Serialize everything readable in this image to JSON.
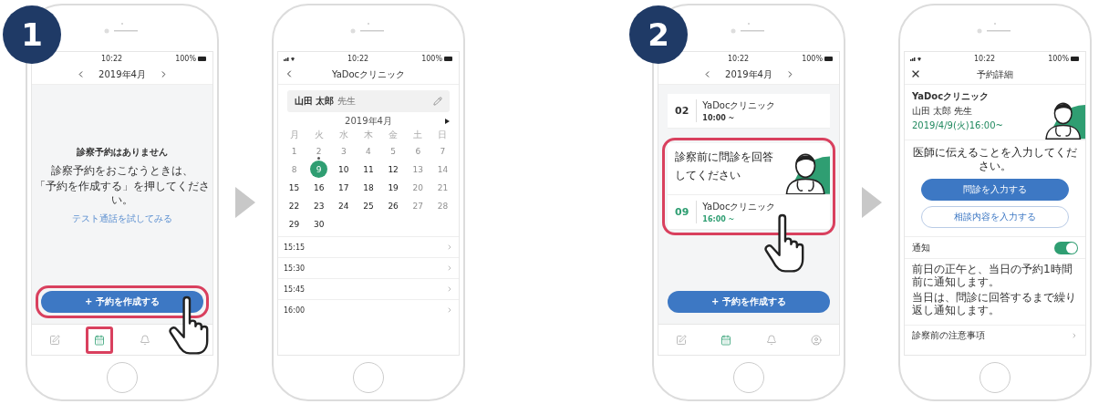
{
  "steps": [
    {
      "number": "1",
      "screens": [
        {
          "kind": "no_appointments",
          "status": {
            "time": "10:22",
            "battery": "100%"
          },
          "month": "2019年4月",
          "empty_title": "診察予約はありません",
          "empty_text": [
            "診察予約をおこなうときは、",
            "「予約を作成する」を押してください。"
          ],
          "test_link": "テスト通話を試してみる",
          "create_button": {
            "label": "+ 予約を作成する",
            "highlighted": true,
            "tapped": true
          },
          "tabs": [
            {
              "selected": false,
              "highlighted": false
            },
            {
              "selected": true,
              "highlighted": true
            },
            {
              "selected": false,
              "highlighted": false
            }
          ]
        },
        {
          "kind": "calendar",
          "status": {
            "time": "10:22",
            "battery": "100%"
          },
          "title": "YaDocクリニック",
          "doctor": {
            "name": "山田 太郎",
            "honorific": "先生"
          },
          "month": "2019年4月",
          "weekdays": [
            "月",
            "火",
            "水",
            "木",
            "金",
            "土",
            "日"
          ],
          "days": [
            {
              "label": "1",
              "disabled": true,
              "selected": false,
              "dot": false
            },
            {
              "label": "2",
              "disabled": true,
              "selected": false,
              "dot": true
            },
            {
              "label": "3",
              "disabled": true,
              "selected": false,
              "dot": false
            },
            {
              "label": "4",
              "disabled": true,
              "selected": false,
              "dot": false
            },
            {
              "label": "5",
              "disabled": true,
              "selected": false,
              "dot": false
            },
            {
              "label": "6",
              "disabled": true,
              "selected": false,
              "dot": false
            },
            {
              "label": "7",
              "disabled": true,
              "selected": false,
              "dot": false
            },
            {
              "label": "8",
              "disabled": true,
              "selected": false,
              "dot": false
            },
            {
              "label": "9",
              "disabled": false,
              "selected": true,
              "dot": false
            },
            {
              "label": "10",
              "disabled": false,
              "selected": false,
              "dot": false
            },
            {
              "label": "11",
              "disabled": false,
              "selected": false,
              "dot": false
            },
            {
              "label": "12",
              "disabled": false,
              "selected": false,
              "dot": false
            },
            {
              "label": "13",
              "disabled": true,
              "selected": false,
              "dot": false
            },
            {
              "label": "14",
              "disabled": true,
              "selected": false,
              "dot": false
            },
            {
              "label": "15",
              "disabled": false,
              "selected": false,
              "dot": false
            },
            {
              "label": "16",
              "disabled": false,
              "selected": false,
              "dot": false
            },
            {
              "label": "17",
              "disabled": false,
              "selected": false,
              "dot": false
            },
            {
              "label": "18",
              "disabled": false,
              "selected": false,
              "dot": false
            },
            {
              "label": "19",
              "disabled": false,
              "selected": false,
              "dot": false
            },
            {
              "label": "20",
              "disabled": true,
              "selected": false,
              "dot": false
            },
            {
              "label": "21",
              "disabled": true,
              "selected": false,
              "dot": false
            },
            {
              "label": "22",
              "disabled": false,
              "selected": false,
              "dot": false
            },
            {
              "label": "23",
              "disabled": false,
              "selected": false,
              "dot": false
            },
            {
              "label": "24",
              "disabled": false,
              "selected": false,
              "dot": false
            },
            {
              "label": "25",
              "disabled": false,
              "selected": false,
              "dot": false
            },
            {
              "label": "26",
              "disabled": false,
              "selected": false,
              "dot": false
            },
            {
              "label": "27",
              "disabled": true,
              "selected": false,
              "dot": false
            },
            {
              "label": "28",
              "disabled": true,
              "selected": false,
              "dot": false
            },
            {
              "label": "29",
              "disabled": false,
              "selected": false,
              "dot": false
            },
            {
              "label": "30",
              "disabled": false,
              "selected": false,
              "dot": false
            }
          ],
          "times": [
            "15:15",
            "15:30",
            "15:45",
            "16:00"
          ]
        }
      ]
    },
    {
      "number": "2",
      "screens": [
        {
          "kind": "appointments",
          "status": {
            "time": "10:22",
            "battery": "100%"
          },
          "month": "2019年4月",
          "appointments": [
            {
              "day": "02",
              "clinic": "YaDocクリニック",
              "time": "10:00 ~",
              "upcoming": false,
              "highlighted": false
            },
            {
              "day": "09",
              "clinic": "YaDocクリニック",
              "time": "16:00 ~",
              "upcoming": true,
              "highlighted": true,
              "tapped": true,
              "prompt": [
                "診察前に問診を回答",
                "してください"
              ]
            }
          ],
          "create_button": {
            "label": "+ 予約を作成する",
            "highlighted": false,
            "tapped": false
          },
          "tabs": [
            {
              "selected": false,
              "highlighted": false
            },
            {
              "selected": true,
              "highlighted": false
            },
            {
              "selected": false,
              "highlighted": false
            },
            {
              "selected": false,
              "highlighted": false
            }
          ]
        },
        {
          "kind": "detail",
          "status": {
            "time": "10:22",
            "battery": "100%"
          },
          "title": "予約詳細",
          "clinic": "YaDocクリニック",
          "doctor": "山田 太郎 先生",
          "datetime": "2019/4/9(火)16:00~",
          "instruction": "医師に伝えることを入力してください。",
          "buttons": [
            {
              "label": "問診を入力する",
              "primary": true
            },
            {
              "label": "相談内容を入力する",
              "primary": false
            }
          ],
          "notification": {
            "label": "通知",
            "on": true
          },
          "note_lines": [
            "前日の正午と、当日の予約1時間前に通知します。",
            "当日は、問診に回答するまで繰り返し通知します。"
          ],
          "precautions": "診察前の注意事項"
        }
      ]
    }
  ]
}
